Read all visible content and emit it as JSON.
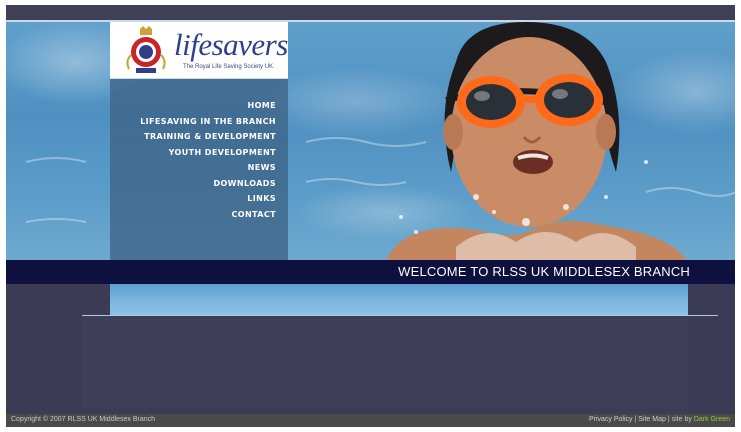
{
  "logo": {
    "wordmark": "lifesavers",
    "tagline": "The Royal Life Saving Society UK",
    "icon": "rlss-crest-icon"
  },
  "nav": {
    "items": [
      {
        "label": "HOME"
      },
      {
        "label": "LIFESAVING IN THE BRANCH"
      },
      {
        "label": "TRAINING & DEVELOPMENT"
      },
      {
        "label": "YOUTH DEVELOPMENT"
      },
      {
        "label": "NEWS"
      },
      {
        "label": "DOWNLOADS"
      },
      {
        "label": "LINKS"
      },
      {
        "label": "CONTACT"
      }
    ]
  },
  "hero": {
    "image": "child-swimming-with-goggles"
  },
  "welcome": {
    "text": "WELCOME TO RLSS UK MIDDLESEX BRANCH"
  },
  "footer": {
    "copyright": "Copyright © 2007 RLSS UK Middlesex Branch",
    "privacy": "Privacy Policy",
    "sep1": "|",
    "sitemap": "Site Map",
    "sep2": "|",
    "site_by": "site by",
    "credit": "Dark Green"
  },
  "colors": {
    "frame": "#3b3b55",
    "welcome_bar": "#0e1040",
    "content_band": "#7ab4df",
    "footer": "#4a4a4a",
    "credit_link": "#9acd32",
    "logo_text": "#2f3f8a"
  }
}
